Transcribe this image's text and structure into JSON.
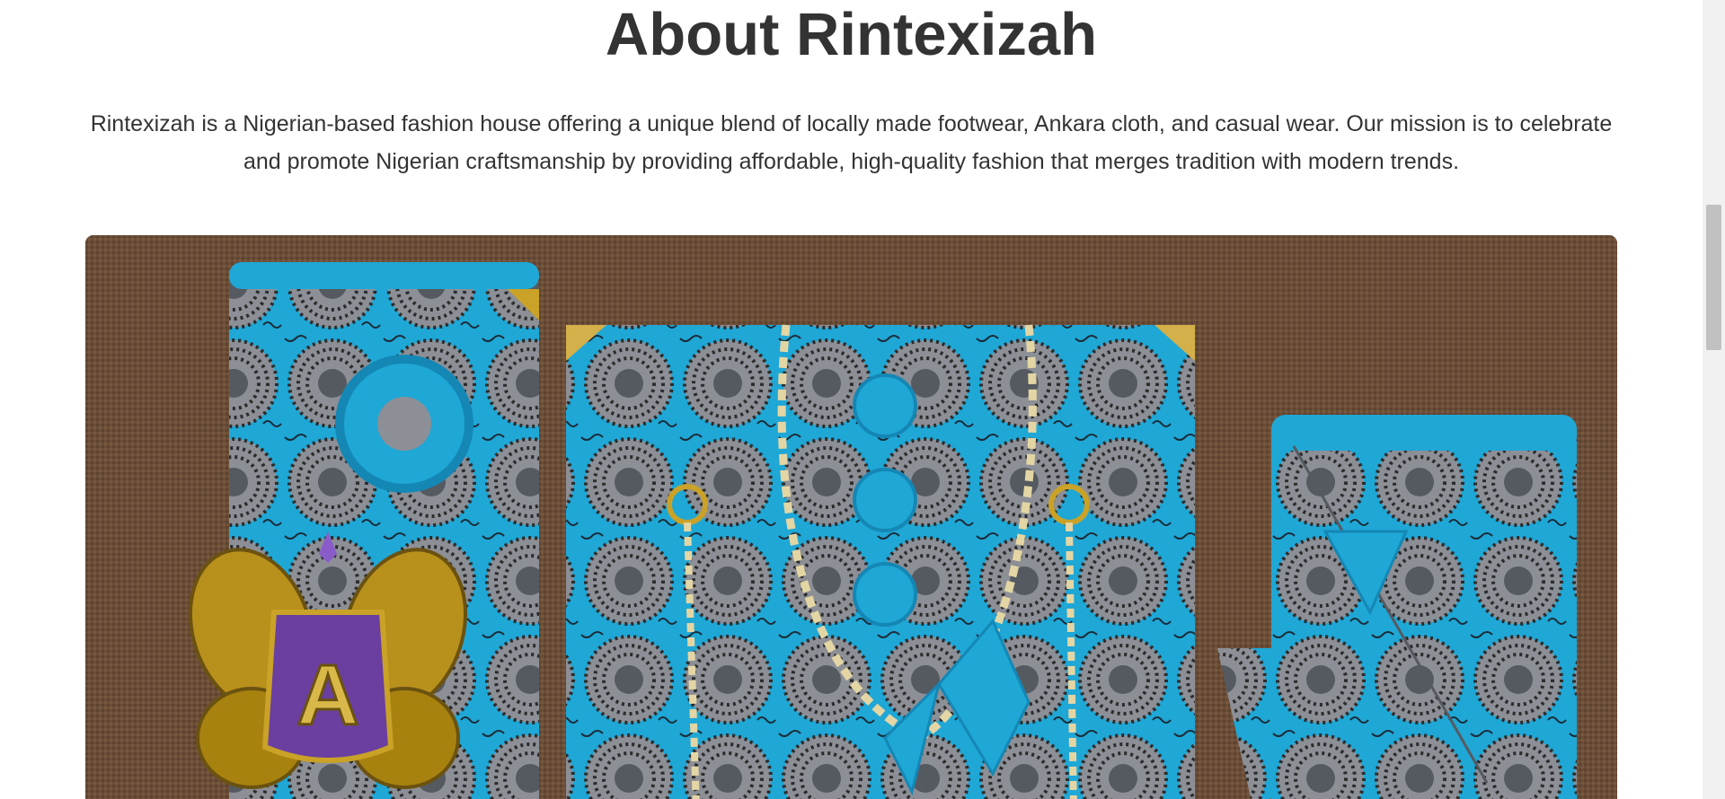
{
  "about": {
    "title": "About Rintexizah",
    "mission": "Rintexizah is a Nigerian-based fashion house offering a unique blend of locally made footwear, Ankara cloth, and casual wear. Our mission is to celebrate and promote Nigerian craftsmanship by providing affordable, high-quality fashion that merges tradition with modern trends."
  },
  "hero_image": {
    "subject": "blue-ankara-bags-and-clutches",
    "logo_letter": "A"
  },
  "colors": {
    "text": "#333333",
    "burlap": "#6b4e38",
    "ankara_blue": "#1fa7d6",
    "gold": "#c9a227",
    "logo_purple": "#6a3fa0"
  }
}
